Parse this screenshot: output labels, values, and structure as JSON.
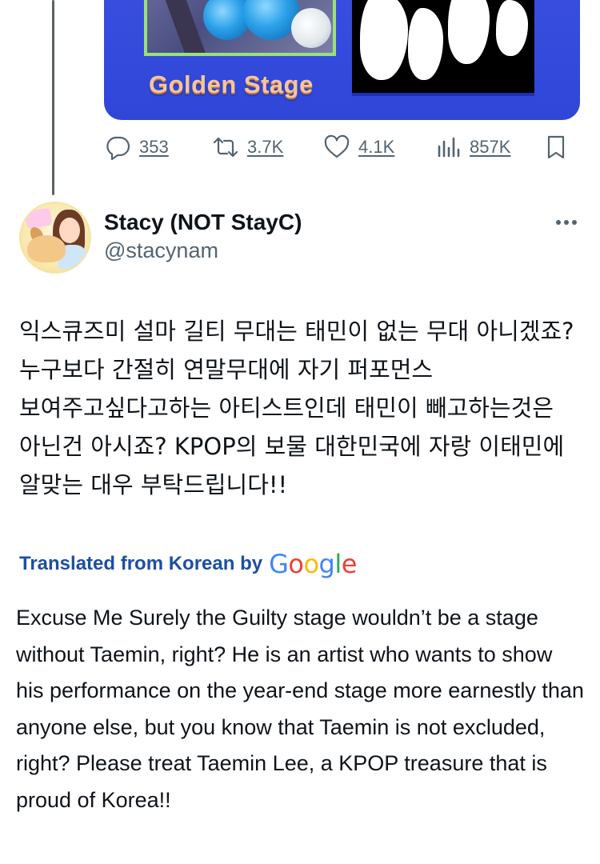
{
  "media": {
    "title": "Golden Stage"
  },
  "actions": {
    "replies": "353",
    "retweets": "3.7K",
    "likes": "4.1K",
    "views": "857K"
  },
  "author": {
    "display_name": "Stacy (NOT StayC)",
    "handle": "@stacynam"
  },
  "tweet": {
    "korean_text": "익스큐즈미 설마 길티 무대는 태민이 없는 무대 아니겠죠? 누구보다 간절히 연말무대에 자기 퍼포먼스 보여주고싶다고하는 아티스트인데 태민이 빼고하는것은 아닌건 아시죠? KPOP의 보물 대한민국에 자랑 이태민에 알맞는 대우 부탁드립니다!!",
    "translated_label": "Translated from Korean by",
    "google_logo": {
      "G": "G",
      "o1": "o",
      "o2": "o",
      "g": "g",
      "l": "l",
      "e": "e"
    },
    "english_text": "Excuse Me Surely the Guilty stage wouldn’t be a stage without Taemin, right? He is an artist who wants to show his performance on the year-end stage more earnestly than anyone else, but you know that Taemin is not excluded, right? Please treat Taemin Lee, a KPOP treasure that is proud of Korea!!"
  },
  "colors": {
    "text_primary": "#0f1419",
    "text_secondary": "#536471",
    "link_blue": "#1d4fa0",
    "card_blue": "#3a4fe0"
  },
  "icons": [
    "reply-icon",
    "retweet-icon",
    "like-icon",
    "views-icon",
    "bookmark-icon",
    "more-icon"
  ]
}
